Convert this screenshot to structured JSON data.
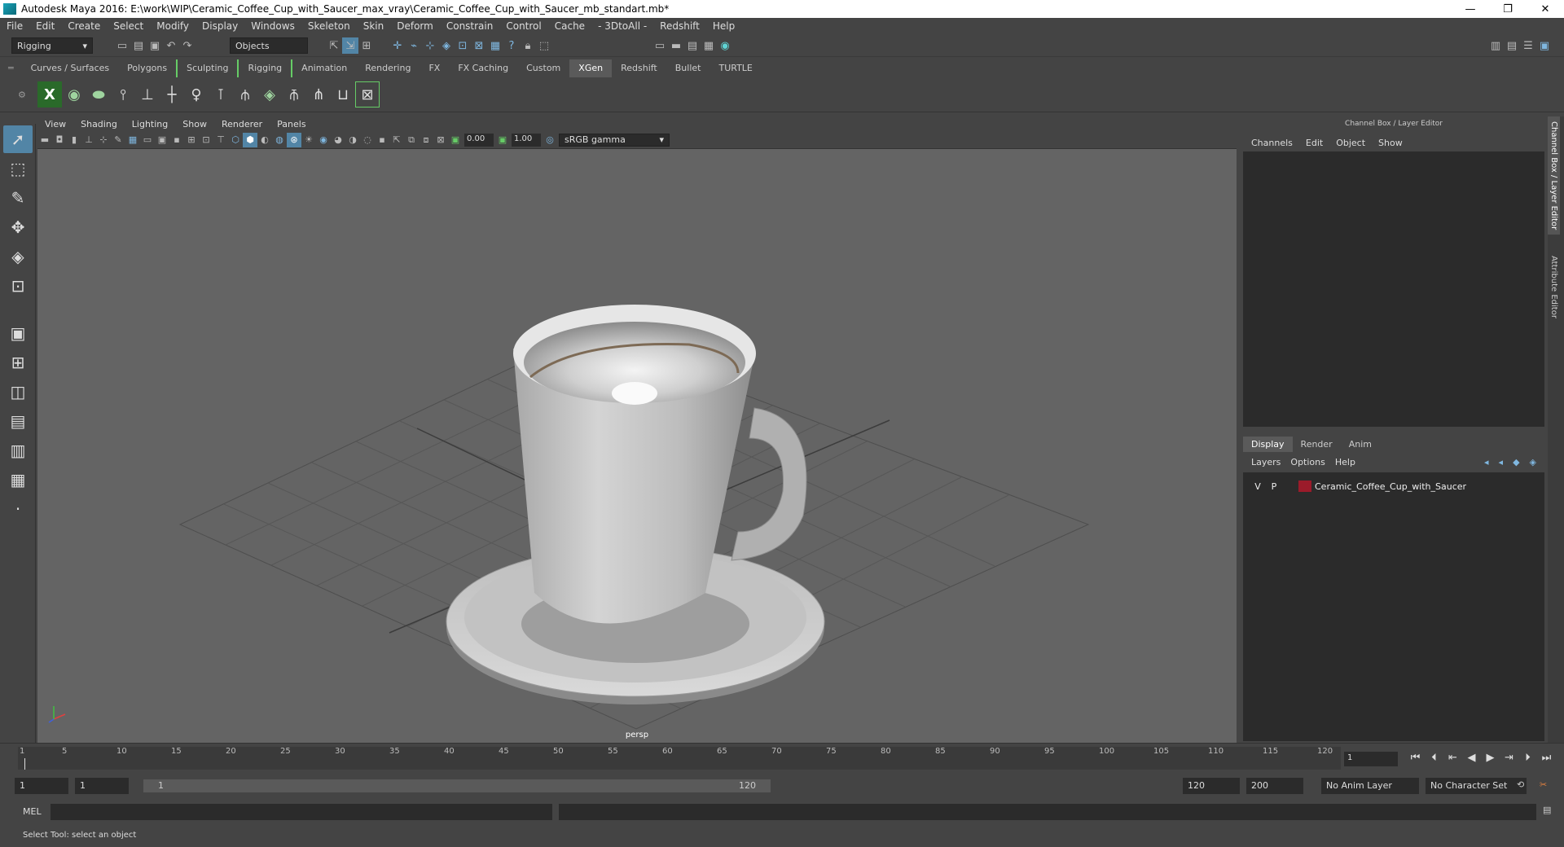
{
  "title_bar": {
    "title": "Autodesk Maya 2016: E:\\work\\WIP\\Ceramic_Coffee_Cup_with_Saucer_max_vray\\Ceramic_Coffee_Cup_with_Saucer_mb_standart.mb*",
    "minimize": "—",
    "restore": "❐",
    "close": "✕"
  },
  "menu": [
    "File",
    "Edit",
    "Create",
    "Select",
    "Modify",
    "Display",
    "Windows",
    "Skeleton",
    "Skin",
    "Deform",
    "Constrain",
    "Control",
    "Cache",
    "- 3DtoAll -",
    "Redshift",
    "Help"
  ],
  "status_line": {
    "menu_set": "Rigging",
    "selection_mode": "Objects"
  },
  "shelf_tabs": {
    "items": [
      "Curves / Surfaces",
      "Polygons",
      "Sculpting",
      "Rigging",
      "Animation",
      "Rendering",
      "FX",
      "FX Caching",
      "Custom",
      "XGen",
      "Redshift",
      "Bullet",
      "TURTLE"
    ],
    "active": "XGen"
  },
  "viewport": {
    "menu": [
      "View",
      "Shading",
      "Lighting",
      "Show",
      "Renderer",
      "Panels"
    ],
    "exposure": "0.00",
    "gamma": "1.00",
    "color_space": "sRGB gamma",
    "camera_label": "persp"
  },
  "channel_box": {
    "header": "Channel Box / Layer Editor",
    "menu": [
      "Channels",
      "Edit",
      "Object",
      "Show"
    ],
    "layer_tabs": [
      "Display",
      "Render",
      "Anim"
    ],
    "active_layer_tab": "Display",
    "layer_menu": [
      "Layers",
      "Options",
      "Help"
    ],
    "layer": {
      "v": "V",
      "p": "P",
      "name": "Ceramic_Coffee_Cup_with_Saucer",
      "color": "#9b1b2a"
    }
  },
  "side_tabs": [
    "Channel Box / Layer Editor",
    "Attribute Editor"
  ],
  "time_slider": {
    "ticks": [
      "1",
      "5",
      "10",
      "15",
      "20",
      "25",
      "30",
      "35",
      "40",
      "45",
      "50",
      "55",
      "60",
      "65",
      "70",
      "75",
      "80",
      "85",
      "90",
      "95",
      "100",
      "105",
      "110",
      "115",
      "120"
    ],
    "current_frame": "1"
  },
  "range_bar": {
    "start": "1",
    "playback_start": "1",
    "slider_start": "1",
    "slider_end": "120",
    "playback_end": "120",
    "end": "200",
    "anim_layer": "No Anim Layer",
    "character_set": "No Character Set"
  },
  "command_line": {
    "label": "MEL"
  },
  "help_line": {
    "text": "Select Tool: select an object"
  }
}
